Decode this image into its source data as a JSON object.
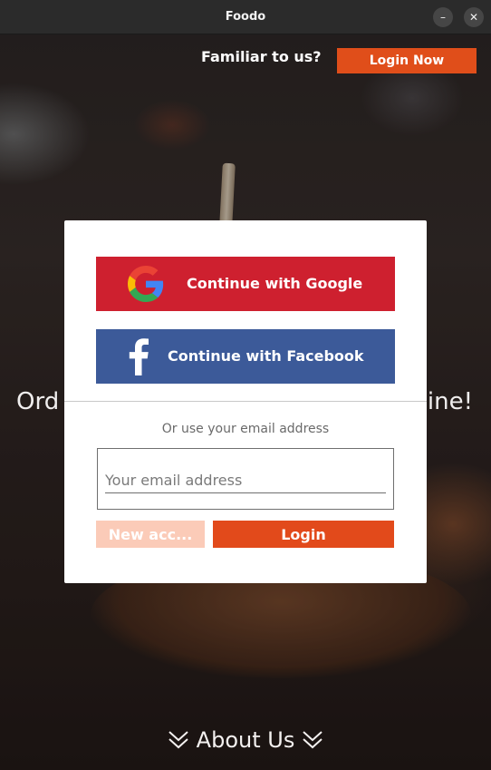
{
  "window": {
    "title": "Foodo",
    "minimize_symbol": "–",
    "close_symbol": "✕"
  },
  "header": {
    "prompt": "Familiar to us?",
    "login_now_label": "Login Now",
    "accent_color": "#e04e1a"
  },
  "hero": {
    "headline_left": "Ord",
    "headline_right": "ine!"
  },
  "dialog": {
    "google_label": "Continue with Google",
    "google_icon": "google-icon",
    "facebook_label": "Continue with Facebook",
    "facebook_icon": "facebook-icon",
    "or_text": "Or use your email address",
    "email_placeholder": "Your email address",
    "email_value": "",
    "new_account_label": "New acc...",
    "login_label": "Login",
    "colors": {
      "google": "#ce202f",
      "facebook": "#3c5a99",
      "login": "#e24a1b",
      "new_account": "#fbcbb8"
    }
  },
  "footer": {
    "about_label": "About Us",
    "chevron_icon": "double-chevron-down-icon"
  }
}
